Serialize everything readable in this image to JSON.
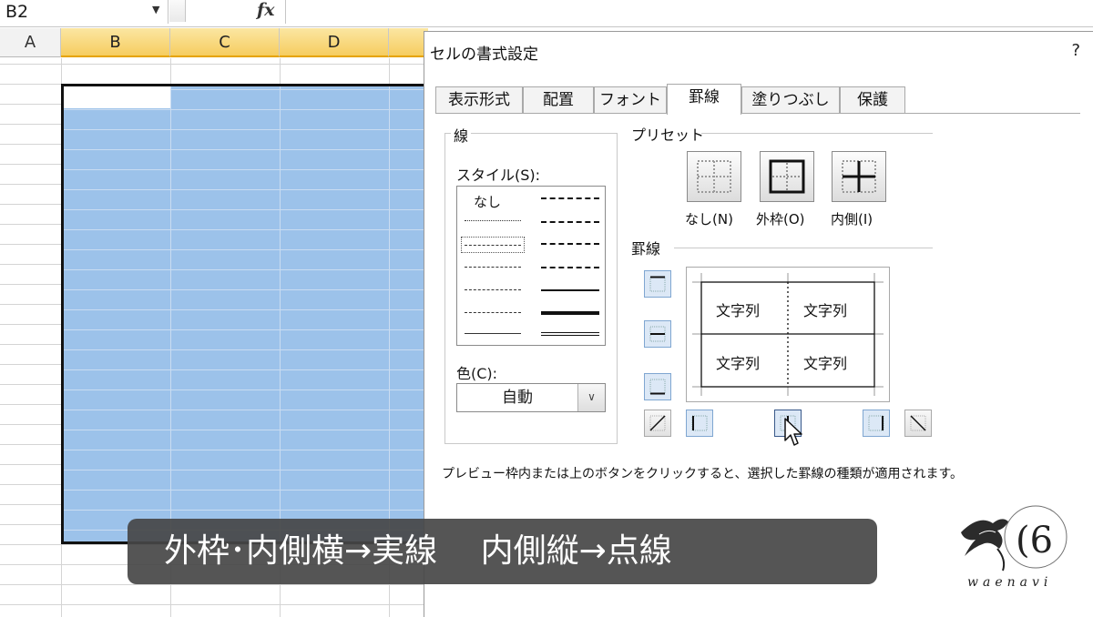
{
  "excel": {
    "name_box": "B2",
    "fx_label": "fx",
    "columns": [
      {
        "label": "A",
        "selected": false
      },
      {
        "label": "B",
        "selected": true
      },
      {
        "label": "C",
        "selected": true
      },
      {
        "label": "D",
        "selected": true
      }
    ],
    "selection_color": "#9cc2ea"
  },
  "dialog": {
    "title": "セルの書式設定",
    "help": "?",
    "tabs": [
      {
        "label": "表示形式",
        "active": false
      },
      {
        "label": "配置",
        "active": false
      },
      {
        "label": "フォント",
        "active": false
      },
      {
        "label": "罫線",
        "active": true
      },
      {
        "label": "塗りつぶし",
        "active": false
      },
      {
        "label": "保護",
        "active": false
      }
    ],
    "line_group": {
      "label": "線",
      "style_label": "スタイル(S):",
      "none_label": "なし",
      "color_label": "色(C):",
      "color_value": "自動"
    },
    "preset": {
      "label": "プリセット",
      "buttons": [
        {
          "label": "なし(N)"
        },
        {
          "label": "外枠(O)"
        },
        {
          "label": "内側(I)"
        }
      ]
    },
    "border": {
      "label": "罫線",
      "preview_cells": [
        "文字列",
        "文字列",
        "文字列",
        "文字列"
      ]
    },
    "hint": "プレビュー枠内または上のボタンをクリックすると、選択した罫線の種類が適用されます。"
  },
  "caption": "外枠･内側横→実線　 内側縦→点線",
  "logo": {
    "text": "waenavi",
    "icon": "bird-logo-icon"
  },
  "colors": {
    "accent_button": "#dce8f6",
    "caption_bg": "#464646"
  }
}
